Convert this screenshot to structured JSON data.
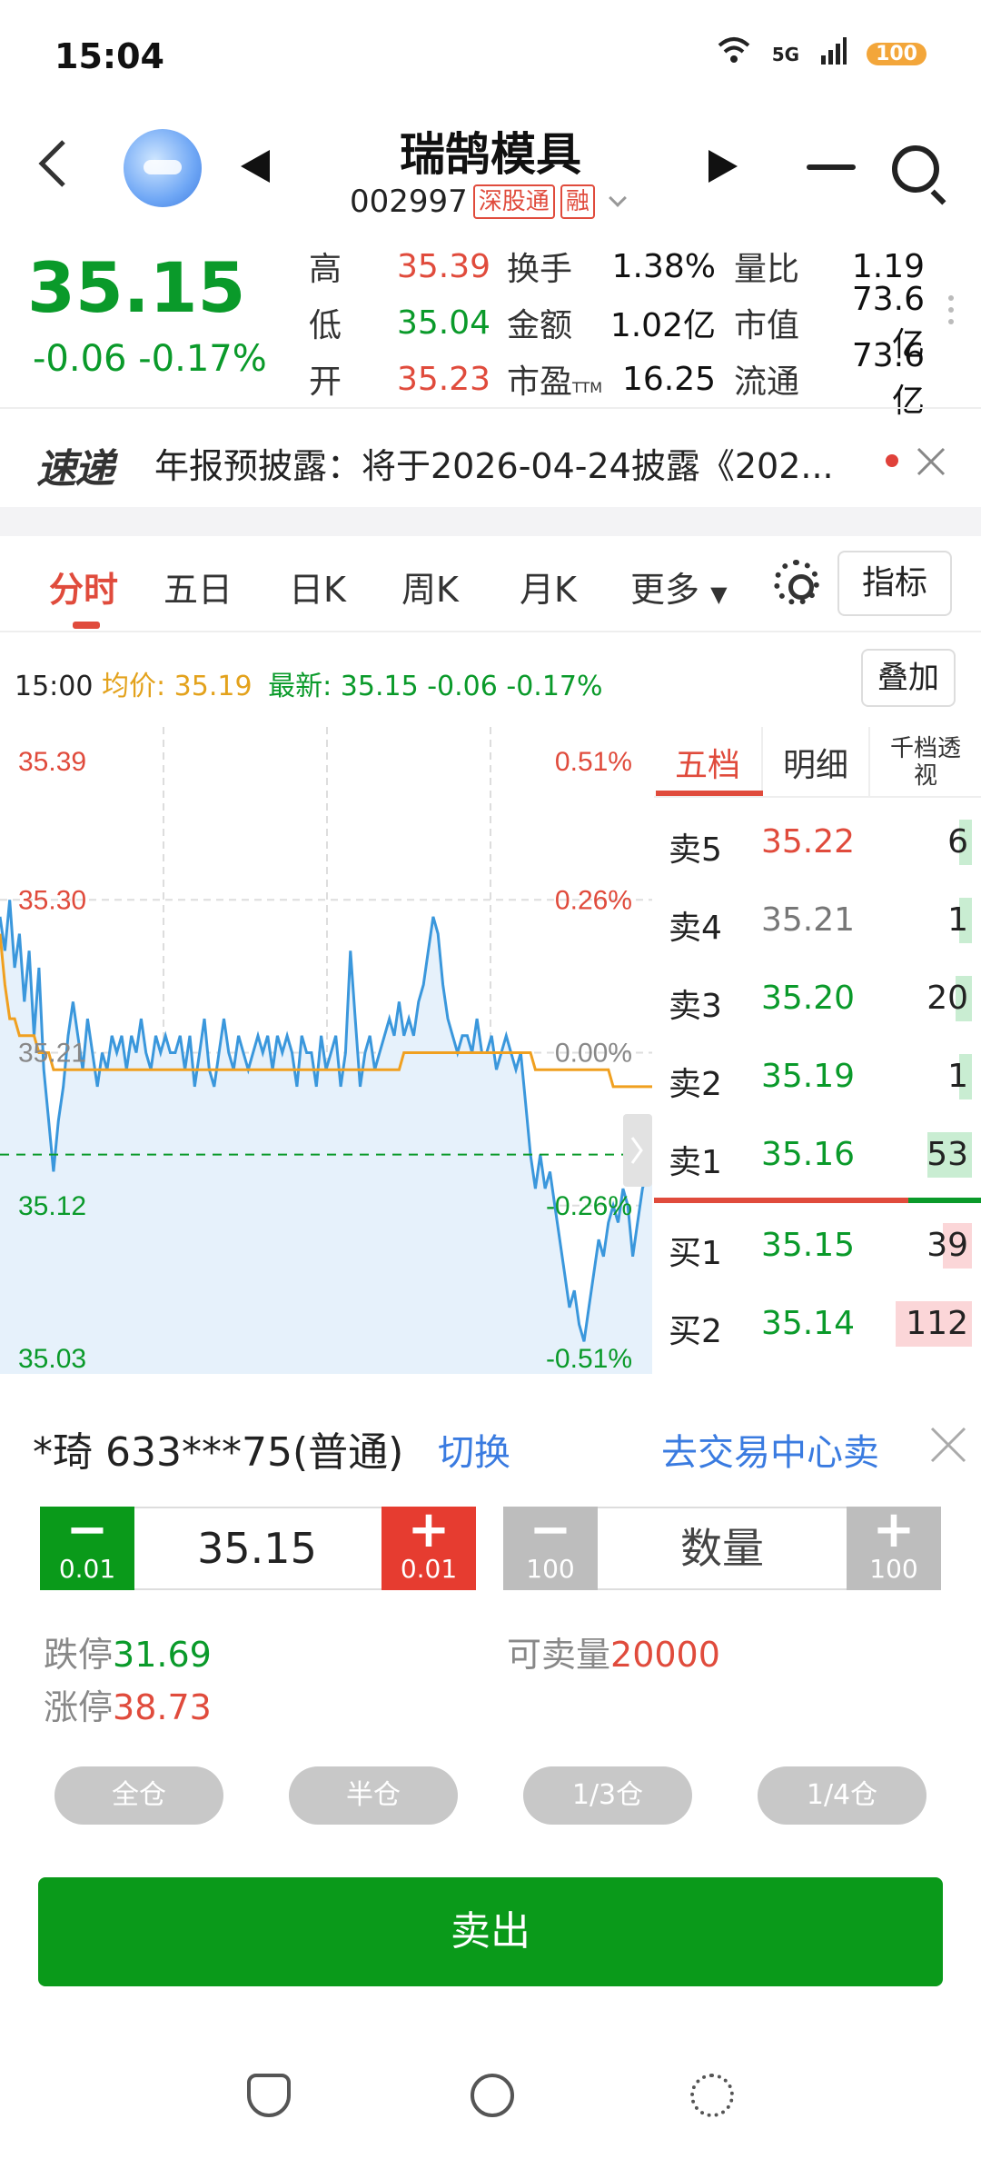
{
  "status_bar": {
    "time": "15:04",
    "net": "5G",
    "badge": "100"
  },
  "header": {
    "stock_name": "瑞鹄模具",
    "stock_code": "002997",
    "tag_hk": "深股通",
    "tag_margin": "融"
  },
  "quote": {
    "price": "35.15",
    "change": "-0.06",
    "change_pct": "-0.17%",
    "rows": [
      {
        "l1": "高",
        "v1": "35.39",
        "c1": "red",
        "l2": "换手",
        "v2": "1.38%",
        "l3": "量比",
        "v3": "1.19"
      },
      {
        "l1": "低",
        "v1": "35.04",
        "c1": "green",
        "l2": "金额",
        "v2": "1.02亿",
        "l3": "市值",
        "v3": "73.6亿"
      },
      {
        "l1": "开",
        "v1": "35.23",
        "c1": "red",
        "l2": "市盈",
        "l2_sub": "TTM",
        "v2": "16.25",
        "l3": "流通",
        "v3": "73.6亿"
      }
    ]
  },
  "news": {
    "logo": "速递",
    "text": "年报预披露：将于2026-04-24披露《202..."
  },
  "chart_tabs": {
    "items": [
      "分时",
      "五日",
      "日K",
      "周K",
      "月K",
      "更多"
    ],
    "active": "分时",
    "indicator_btn": "指标"
  },
  "info_line": {
    "time": "15:00",
    "avg_label": "均价:",
    "avg_value": "35.19",
    "latest_label": "最新:",
    "latest_value": "35.15",
    "latest_chg": "-0.06",
    "latest_pct": "-0.17%"
  },
  "overlay_btn": "叠加",
  "chart_data": {
    "type": "line",
    "y_ticks": [
      "35.39",
      "35.30",
      "35.21",
      "35.12",
      "35.03"
    ],
    "pct_ticks": [
      "0.51%",
      "0.26%",
      "0.00%",
      "-0.26%",
      "-0.51%"
    ],
    "ylim": [
      35.03,
      35.39
    ],
    "prev_close": 35.21,
    "series": [
      {
        "values": [
          35.29,
          35.27,
          35.3,
          35.26,
          35.28,
          35.24,
          35.27,
          35.22,
          35.26,
          35.2,
          35.17,
          35.14,
          35.17,
          35.19,
          35.22,
          35.24,
          35.22,
          35.2,
          35.23,
          35.21,
          35.19,
          35.21,
          35.2,
          35.22,
          35.21,
          35.22,
          35.2,
          35.22,
          35.21,
          35.23,
          35.21,
          35.2,
          35.22,
          35.21,
          35.22,
          35.21,
          35.21,
          35.22,
          35.2,
          35.22,
          35.19,
          35.21,
          35.23,
          35.2,
          35.19,
          35.21,
          35.23,
          35.21,
          35.2,
          35.22,
          35.21,
          35.2,
          35.21,
          35.22,
          35.21,
          35.22,
          35.2,
          35.22,
          35.21,
          35.22,
          35.21,
          35.19,
          35.22,
          35.21,
          35.21,
          35.19,
          35.22,
          35.2,
          35.21,
          35.22,
          35.19,
          35.21,
          35.27,
          35.23,
          35.19,
          35.21,
          35.22,
          35.2,
          35.21,
          35.22,
          35.23,
          35.22,
          35.24,
          35.22,
          35.23,
          35.22,
          35.24,
          35.25,
          35.27,
          35.29,
          35.28,
          35.25,
          35.23,
          35.22,
          35.21,
          35.22,
          35.22,
          35.21,
          35.23,
          35.21,
          35.21,
          35.22,
          35.2,
          35.21,
          35.22,
          35.21,
          35.2,
          35.21,
          35.18,
          35.15,
          35.13,
          35.15,
          35.13,
          35.14,
          35.12,
          35.1,
          35.08,
          35.06,
          35.07,
          35.05,
          35.04,
          35.06,
          35.08,
          35.1,
          35.09,
          35.11,
          35.12,
          35.11,
          35.13,
          35.12,
          35.09,
          35.11,
          35.13,
          35.14,
          35.15
        ]
      },
      {
        "values": [
          35.28,
          35.25,
          35.23,
          35.23,
          35.22,
          35.22,
          35.22,
          35.22,
          35.21,
          35.21,
          35.21,
          35.2,
          35.2,
          35.2,
          35.2,
          35.2,
          35.2,
          35.2,
          35.2,
          35.2,
          35.2,
          35.2,
          35.2,
          35.2,
          35.2,
          35.2,
          35.2,
          35.2,
          35.2,
          35.2,
          35.2,
          35.2,
          35.2,
          35.2,
          35.2,
          35.2,
          35.2,
          35.2,
          35.2,
          35.2,
          35.2,
          35.2,
          35.2,
          35.2,
          35.2,
          35.2,
          35.2,
          35.2,
          35.2,
          35.2,
          35.2,
          35.2,
          35.2,
          35.2,
          35.2,
          35.2,
          35.2,
          35.2,
          35.2,
          35.2,
          35.2,
          35.2,
          35.2,
          35.2,
          35.2,
          35.2,
          35.2,
          35.2,
          35.2,
          35.2,
          35.2,
          35.2,
          35.2,
          35.2,
          35.2,
          35.2,
          35.2,
          35.2,
          35.2,
          35.2,
          35.2,
          35.2,
          35.2,
          35.21,
          35.21,
          35.21,
          35.21,
          35.21,
          35.21,
          35.21,
          35.21,
          35.21,
          35.21,
          35.21,
          35.21,
          35.21,
          35.21,
          35.21,
          35.21,
          35.21,
          35.21,
          35.21,
          35.21,
          35.21,
          35.21,
          35.21,
          35.21,
          35.21,
          35.21,
          35.21,
          35.2,
          35.2,
          35.2,
          35.2,
          35.2,
          35.2,
          35.2,
          35.2,
          35.2,
          35.2,
          35.2,
          35.2,
          35.2,
          35.2,
          35.2,
          35.2,
          35.19,
          35.19,
          35.19,
          35.19,
          35.19,
          35.19,
          35.19,
          35.19,
          35.19
        ]
      }
    ],
    "colors": {
      "price_line": "#3a97dc",
      "avg_line": "#f0a020",
      "fill": "#e6f1fb",
      "up": "#e04b3c",
      "down": "#0a9a2a"
    }
  },
  "order_book": {
    "tabs": [
      "五档",
      "明细",
      "千档透视"
    ],
    "asks": [
      {
        "name": "卖5",
        "price": "35.22",
        "color": "red",
        "qty": "6",
        "bar": 0.02
      },
      {
        "name": "卖4",
        "price": "35.21",
        "color": "gray",
        "qty": "1",
        "bar": 0.01
      },
      {
        "name": "卖3",
        "price": "35.20",
        "color": "green",
        "qty": "20",
        "bar": 0.05
      },
      {
        "name": "卖2",
        "price": "35.19",
        "color": "green",
        "qty": "1",
        "bar": 0.01
      },
      {
        "name": "卖1",
        "price": "35.16",
        "color": "green",
        "qty": "53",
        "bar": 0.14
      }
    ],
    "bids": [
      {
        "name": "买1",
        "price": "35.15",
        "color": "green",
        "qty": "39",
        "bar": 0.09
      },
      {
        "name": "买2",
        "price": "35.14",
        "color": "green",
        "qty": "112",
        "bar": 0.24
      }
    ]
  },
  "trade": {
    "account": "*琦 633***75(普通)",
    "switch_label": "切换",
    "trade_center_label": "去交易中心卖",
    "price_value": "35.15",
    "price_step": "0.01",
    "qty_placeholder": "数量",
    "qty_step": "100",
    "limit_down_label": "跌停",
    "limit_down_value": "31.69",
    "limit_up_label": "涨停",
    "limit_up_value": "38.73",
    "sellable_label": "可卖量",
    "sellable_value": "20000",
    "position_buttons": [
      "全仓",
      "半仓",
      "1/3仓",
      "1/4仓"
    ],
    "sell_label": "卖出"
  },
  "bottom_icons": [
    "ingot-icon",
    "currency-icon",
    "settings-icon"
  ]
}
